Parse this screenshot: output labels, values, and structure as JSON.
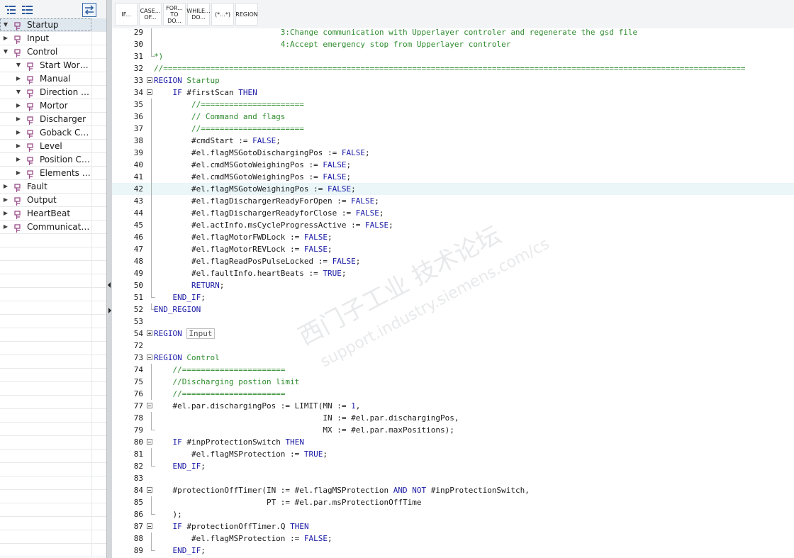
{
  "tree": {
    "toolbar": {
      "expand_icon": "expand-all-icon",
      "collapse_icon": "collapse-all-icon",
      "sync_icon": "synchronize-icon"
    },
    "items": [
      {
        "label": "Startup",
        "level": 0,
        "caret": "▼",
        "selected": true
      },
      {
        "label": "Input",
        "level": 0,
        "caret": "▶",
        "selected": false
      },
      {
        "label": "Control",
        "level": 0,
        "caret": "▼",
        "selected": false
      },
      {
        "label": "Start Workin...",
        "level": 1,
        "caret": "▼",
        "selected": false
      },
      {
        "label": "Manual",
        "level": 1,
        "caret": "▶",
        "selected": false
      },
      {
        "label": "Direction an...",
        "level": 1,
        "caret": "▼",
        "selected": false
      },
      {
        "label": "Mortor",
        "level": 1,
        "caret": "▶",
        "selected": false
      },
      {
        "label": "Discharger",
        "level": 1,
        "caret": "▶",
        "selected": false
      },
      {
        "label": "Goback Con...",
        "level": 1,
        "caret": "▶",
        "selected": false
      },
      {
        "label": "Level",
        "level": 1,
        "caret": "▶",
        "selected": false
      },
      {
        "label": "Position Cal...",
        "level": 1,
        "caret": "▶",
        "selected": false
      },
      {
        "label": "Elements Fa...",
        "level": 1,
        "caret": "▶",
        "selected": false
      },
      {
        "label": "Fault",
        "level": 0,
        "caret": "▶",
        "selected": false
      },
      {
        "label": "Output",
        "level": 0,
        "caret": "▶",
        "selected": false
      },
      {
        "label": "HeartBeat",
        "level": 0,
        "caret": "▶",
        "selected": false
      },
      {
        "label": "Communicatio...",
        "level": 0,
        "caret": "▶",
        "selected": false
      }
    ]
  },
  "snippets": [
    {
      "l1": "IF...",
      "l2": ""
    },
    {
      "l1": "CASE...",
      "l2": "OF..."
    },
    {
      "l1": "FOR...",
      "l2": "TO DO..."
    },
    {
      "l1": "WHILE...",
      "l2": "DO..."
    },
    {
      "l1": "(*...*)",
      "l2": ""
    },
    {
      "l1": "REGION",
      "l2": ""
    }
  ],
  "code": {
    "lines": [
      {
        "n": "29",
        "fold": "guide",
        "parts": [
          [
            "cm",
            "                           3:Change communication with Upperlayer controler and regenerate the gsd file"
          ]
        ]
      },
      {
        "n": "30",
        "fold": "guide",
        "parts": [
          [
            "cm",
            "                           4:Accept emergency stop from Upperlayer controler"
          ]
        ]
      },
      {
        "n": "31",
        "fold": "end",
        "parts": [
          [
            "cm",
            "*)"
          ]
        ]
      },
      {
        "n": "32",
        "fold": "",
        "parts": [
          [
            "cm",
            "//============================================================================================================================"
          ]
        ]
      },
      {
        "n": "33",
        "fold": "minus",
        "parts": [
          [
            "kw",
            "REGION"
          ],
          [
            "cm",
            " Startup"
          ]
        ]
      },
      {
        "n": "34",
        "fold": "minus",
        "parts": [
          [
            "vr",
            "    "
          ],
          [
            "kw",
            "IF"
          ],
          [
            "vr",
            " #firstScan "
          ],
          [
            "kw",
            "THEN"
          ]
        ]
      },
      {
        "n": "35",
        "fold": "guide",
        "parts": [
          [
            "cm",
            "        //======================"
          ]
        ]
      },
      {
        "n": "36",
        "fold": "guide",
        "parts": [
          [
            "cm",
            "        // Command and flags"
          ]
        ]
      },
      {
        "n": "37",
        "fold": "guide",
        "parts": [
          [
            "cm",
            "        //======================"
          ]
        ]
      },
      {
        "n": "38",
        "fold": "guide",
        "parts": [
          [
            "vr",
            "        #cmdStart := "
          ],
          [
            "kw",
            "FALSE"
          ],
          [
            "vr",
            ";"
          ]
        ]
      },
      {
        "n": "39",
        "fold": "guide",
        "parts": [
          [
            "vr",
            "        #el.flagMSGotoDischargingPos := "
          ],
          [
            "kw",
            "FALSE"
          ],
          [
            "vr",
            ";"
          ]
        ]
      },
      {
        "n": "40",
        "fold": "guide",
        "parts": [
          [
            "vr",
            "        #el.cmdMSGotoWeighingPos := "
          ],
          [
            "kw",
            "FALSE"
          ],
          [
            "vr",
            ";"
          ]
        ]
      },
      {
        "n": "41",
        "fold": "guide",
        "parts": [
          [
            "vr",
            "        #el.cmdMSGotoWeighingPos := "
          ],
          [
            "kw",
            "FALSE"
          ],
          [
            "vr",
            ";"
          ]
        ]
      },
      {
        "n": "42",
        "fold": "guide",
        "hl": true,
        "parts": [
          [
            "vr",
            "        #el.flagMSGotoWeighingPos := "
          ],
          [
            "kw",
            "FALSE"
          ],
          [
            "vr",
            ";"
          ]
        ]
      },
      {
        "n": "43",
        "fold": "guide",
        "parts": [
          [
            "vr",
            "        #el.flagDischargerReadyForOpen := "
          ],
          [
            "kw",
            "FALSE"
          ],
          [
            "vr",
            ";"
          ]
        ]
      },
      {
        "n": "44",
        "fold": "guide",
        "parts": [
          [
            "vr",
            "        #el.flagDischargerReadyforClose := "
          ],
          [
            "kw",
            "FALSE"
          ],
          [
            "vr",
            ";"
          ]
        ]
      },
      {
        "n": "45",
        "fold": "guide",
        "parts": [
          [
            "vr",
            "        #el.actInfo.msCycleProgressActive := "
          ],
          [
            "kw",
            "FALSE"
          ],
          [
            "vr",
            ";"
          ]
        ]
      },
      {
        "n": "46",
        "fold": "guide",
        "parts": [
          [
            "vr",
            "        #el.flagMotorFWDLock := "
          ],
          [
            "kw",
            "FALSE"
          ],
          [
            "vr",
            ";"
          ]
        ]
      },
      {
        "n": "47",
        "fold": "guide",
        "parts": [
          [
            "vr",
            "        #el.flagMotorREVLock := "
          ],
          [
            "kw",
            "FALSE"
          ],
          [
            "vr",
            ";"
          ]
        ]
      },
      {
        "n": "48",
        "fold": "guide",
        "parts": [
          [
            "vr",
            "        #el.flagReadPosPulseLocked := "
          ],
          [
            "kw",
            "FALSE"
          ],
          [
            "vr",
            ";"
          ]
        ]
      },
      {
        "n": "49",
        "fold": "guide",
        "parts": [
          [
            "vr",
            "        #el.faultInfo.heartBeats := "
          ],
          [
            "kw",
            "TRUE"
          ],
          [
            "vr",
            ";"
          ]
        ]
      },
      {
        "n": "50",
        "fold": "guide",
        "parts": [
          [
            "kw",
            "        RETURN"
          ],
          [
            "vr",
            ";"
          ]
        ]
      },
      {
        "n": "51",
        "fold": "end",
        "parts": [
          [
            "kw",
            "    END_IF"
          ],
          [
            "vr",
            ";"
          ]
        ]
      },
      {
        "n": "52",
        "fold": "end",
        "parts": [
          [
            "kw",
            "END_REGION"
          ]
        ]
      },
      {
        "n": "53",
        "fold": "",
        "parts": [
          [
            "vr",
            ""
          ]
        ]
      },
      {
        "n": "54",
        "fold": "plus",
        "parts": [
          [
            "kw",
            "REGION"
          ],
          [
            "vr",
            " "
          ],
          [
            "box",
            "Input"
          ]
        ]
      },
      {
        "n": "72",
        "fold": "",
        "parts": [
          [
            "vr",
            ""
          ]
        ]
      },
      {
        "n": "73",
        "fold": "minus",
        "parts": [
          [
            "kw",
            "REGION"
          ],
          [
            "cm",
            " Control"
          ]
        ]
      },
      {
        "n": "74",
        "fold": "guide",
        "parts": [
          [
            "cm",
            "    //======================"
          ]
        ]
      },
      {
        "n": "75",
        "fold": "guide",
        "parts": [
          [
            "cm",
            "    //Discharging postion limit"
          ]
        ]
      },
      {
        "n": "76",
        "fold": "guide",
        "parts": [
          [
            "cm",
            "    //======================"
          ]
        ]
      },
      {
        "n": "77",
        "fold": "minus",
        "parts": [
          [
            "vr",
            "    #el.par.dischargingPos := LIMIT(MN := "
          ],
          [
            "kw",
            "1"
          ],
          [
            "vr",
            ","
          ]
        ]
      },
      {
        "n": "78",
        "fold": "guide",
        "parts": [
          [
            "vr",
            "                                    IN := #el.par.dischargingPos,"
          ]
        ]
      },
      {
        "n": "79",
        "fold": "end",
        "parts": [
          [
            "vr",
            "                                    MX := #el.par.maxPositions);"
          ]
        ]
      },
      {
        "n": "80",
        "fold": "minus",
        "parts": [
          [
            "vr",
            "    "
          ],
          [
            "kw",
            "IF"
          ],
          [
            "vr",
            " #inpProtectionSwitch "
          ],
          [
            "kw",
            "THEN"
          ]
        ]
      },
      {
        "n": "81",
        "fold": "guide",
        "parts": [
          [
            "vr",
            "        #el.flagMSProtection := "
          ],
          [
            "kw",
            "TRUE"
          ],
          [
            "vr",
            ";"
          ]
        ]
      },
      {
        "n": "82",
        "fold": "end",
        "parts": [
          [
            "kw",
            "    END_IF"
          ],
          [
            "vr",
            ";"
          ]
        ]
      },
      {
        "n": "83",
        "fold": "",
        "parts": [
          [
            "vr",
            ""
          ]
        ]
      },
      {
        "n": "84",
        "fold": "minus",
        "parts": [
          [
            "vr",
            "    #protectionOffTimer(IN := #el.flagMSProtection "
          ],
          [
            "kw",
            "AND NOT"
          ],
          [
            "vr",
            " #inpProtectionSwitch,"
          ]
        ]
      },
      {
        "n": "85",
        "fold": "guide",
        "parts": [
          [
            "vr",
            "                        PT := #el.par.msProtectionOffTime"
          ]
        ]
      },
      {
        "n": "86",
        "fold": "end",
        "parts": [
          [
            "vr",
            "    );"
          ]
        ]
      },
      {
        "n": "87",
        "fold": "minus",
        "parts": [
          [
            "vr",
            "    "
          ],
          [
            "kw",
            "IF"
          ],
          [
            "vr",
            " #protectionOffTimer.Q "
          ],
          [
            "kw",
            "THEN"
          ]
        ]
      },
      {
        "n": "88",
        "fold": "guide",
        "parts": [
          [
            "vr",
            "        #el.flagMSProtection := "
          ],
          [
            "kw",
            "FALSE"
          ],
          [
            "vr",
            ";"
          ]
        ]
      },
      {
        "n": "89",
        "fold": "end",
        "parts": [
          [
            "kw",
            "    END_IF"
          ],
          [
            "vr",
            ";"
          ]
        ]
      }
    ]
  },
  "watermark": {
    "line1": "西门子工业 技术论坛",
    "line2": "support.industry.siemens.com/cs"
  },
  "colors": {
    "keyword": "#1a1aa6",
    "comment": "#2e8b2e",
    "highlight": "#eaf6f8",
    "selected": "#dfe7ef"
  }
}
